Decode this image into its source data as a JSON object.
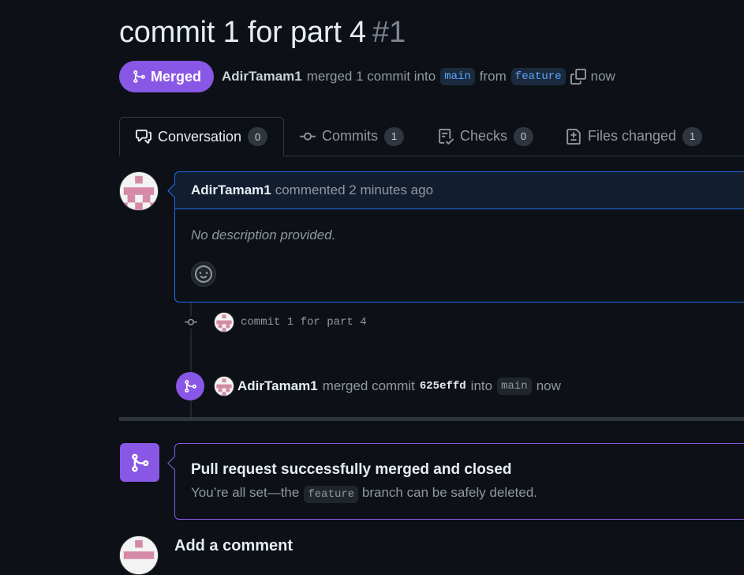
{
  "header": {
    "title": "commit 1 for part 4",
    "number": "#1"
  },
  "status": {
    "badge_label": "Merged",
    "author": "AdirTamam1",
    "text_before": "merged 1 commit into",
    "base_branch": "main",
    "text_from": "from",
    "head_branch": "feature",
    "time": "now"
  },
  "tabs": [
    {
      "label": "Conversation",
      "count": "0",
      "icon": "comment-discussion-icon"
    },
    {
      "label": "Commits",
      "count": "1",
      "icon": "git-commit-icon"
    },
    {
      "label": "Checks",
      "count": "0",
      "icon": "checklist-icon"
    },
    {
      "label": "Files changed",
      "count": "1",
      "icon": "file-diff-icon"
    }
  ],
  "comment": {
    "author": "AdirTamam1",
    "meta": "commented 2 minutes ago",
    "body": "No description provided."
  },
  "timeline": {
    "commit_message": "commit 1 for part 4",
    "merge_author": "AdirTamam1",
    "merge_text": "merged commit",
    "sha": "625effd",
    "into_text": "into",
    "branch": "main",
    "time": "now"
  },
  "merged_box": {
    "title": "Pull request successfully merged and closed",
    "sub_before": "You’re all set—the",
    "branch": "feature",
    "sub_after": "branch can be safely deleted."
  },
  "add_comment": {
    "heading": "Add a comment"
  },
  "colors": {
    "merged_purple": "#8957e5",
    "link_blue": "#58a6ff",
    "background": "#0d1117"
  }
}
